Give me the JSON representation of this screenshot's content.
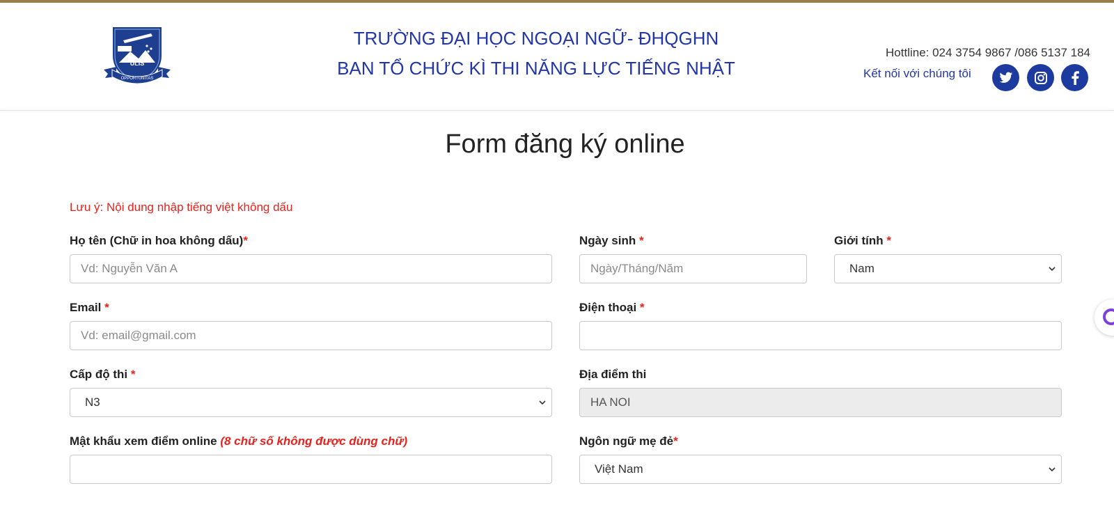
{
  "header": {
    "school_line1": "TRƯỜNG ĐẠI HỌC NGOẠI NGỮ- ĐHQGHN",
    "school_line2": "BAN TỔ CHỨC KÌ THI NĂNG LỰC TIẾNG NHẬT",
    "hotline": "Hottline: 024 3754 9867 /086 5137 184",
    "connect": "Kết nối với chúng tôi",
    "logo_text": "ULIS",
    "logo_motto": "OPPORTUNITAS",
    "social": [
      "twitter-icon",
      "instagram-icon",
      "facebook-icon"
    ]
  },
  "form": {
    "title": "Form đăng ký online",
    "note": "Lưu ý: Nội dung nhập tiếng việt không dấu",
    "required_mark": "*",
    "fullname": {
      "label": "Họ tên (Chữ in hoa không dấu)",
      "placeholder": "Vd: Nguyễn Văn A",
      "value": ""
    },
    "dob": {
      "label": "Ngày sinh",
      "placeholder": "Ngày/Tháng/Năm",
      "value": ""
    },
    "gender": {
      "label": "Giới tính",
      "value": "Nam"
    },
    "email": {
      "label": "Email",
      "placeholder": "Vd: email@gmail.com",
      "value": ""
    },
    "phone": {
      "label": "Điện thoại",
      "placeholder": "",
      "value": ""
    },
    "level": {
      "label": "Cấp độ thi",
      "value": "N3"
    },
    "location": {
      "label": "Địa điểm thi",
      "value": "HA NOI"
    },
    "password": {
      "label": "Mật khẩu xem điểm online",
      "hint": "(8 chữ số không được dùng chữ)",
      "value": ""
    },
    "native_language": {
      "label": "Ngôn ngữ mẹ đẻ",
      "value": "Việt Nam"
    }
  },
  "colors": {
    "brand_blue": "#2236a8",
    "top_bar": "#9a7f4c",
    "required_red": "#e8221c"
  }
}
